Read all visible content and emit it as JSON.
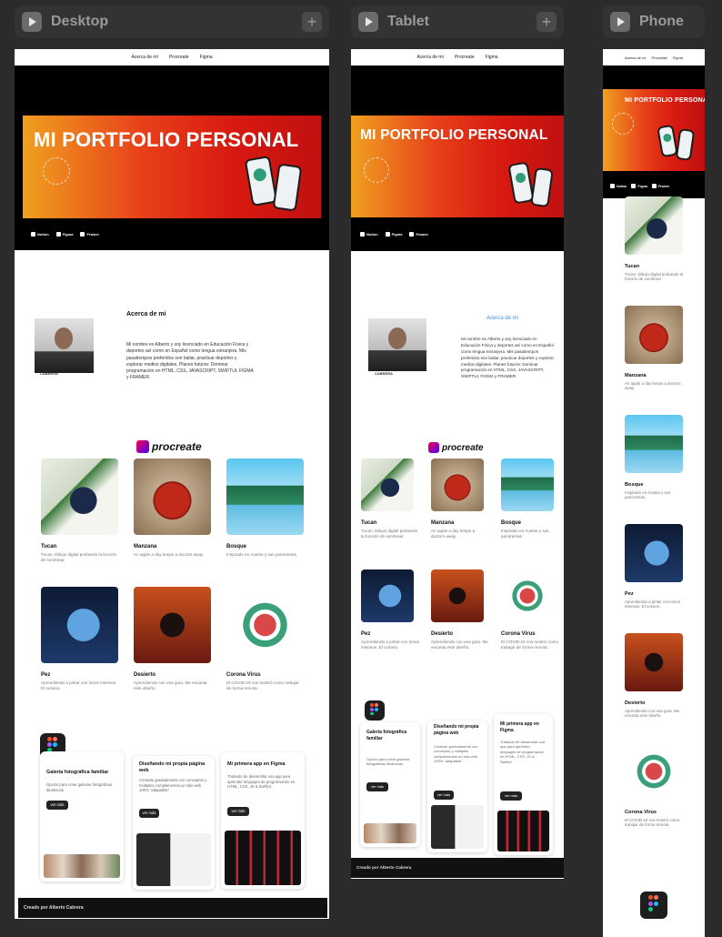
{
  "frames": {
    "desktop": {
      "label": "Desktop"
    },
    "tablet": {
      "label": "Tablet"
    },
    "phone": {
      "label": "Phone"
    }
  },
  "nav": {
    "about": "Acerca de mí",
    "procreate": "Procreate",
    "figma": "Figma"
  },
  "hero": {
    "title": "MI PORTFOLIO PERSONAL",
    "circle_text": "ALBERTO · CABRERA · 00"
  },
  "tools": {
    "notion": "Notion",
    "figma": "Figma",
    "framer": "Framer"
  },
  "about": {
    "heading": "Acerca de mi",
    "photo_caption": "CABRERA",
    "body": "Mi nombre es Alberto y soy licenciado en Educación Física y deportes así como en Español como lengua extranjera. Mis pasatiempos preferidos son bailar, practicar deportes y explorar medios digitales. Planes futuros: Dominar programación en HTML, CSS, JAVASCRIPT, SWIFTUI, FIGMA y FRAMER."
  },
  "procreate": {
    "badge": "procreate",
    "cards": [
      {
        "title": "Tucan",
        "desc": "Tucan. Dibujo digital probando la función de sombrear."
      },
      {
        "title": "Manzana",
        "desc": "An apple a day keeps a doctors away."
      },
      {
        "title": "Bosque",
        "desc": "Inspirado en Austria y sus panoramas."
      },
      {
        "title": "Pez",
        "desc": "Aprendiendo a pintar con tonos intensos. El océano."
      },
      {
        "title": "Desierto",
        "desc": "Aprendiendo con una guía. Me encanta este diseño."
      },
      {
        "title": "Corona Virus",
        "desc": "El COVID-19 nos mostró como trabajar de forma remota."
      }
    ]
  },
  "figma": {
    "projects": [
      {
        "title": "Galería fotográfica familiar",
        "desc": "Opción para crear galerías fotográficas dinámicas.",
        "button": "ver más"
      },
      {
        "title": "Diseñando mi propia página web",
        "desc": "Creando gradualmente con conceptos y múltiples complementos un sitio web 100% \"adaptable\"",
        "button": "ver más"
      },
      {
        "title": "Mi primera app en Figma",
        "desc": "Tratando de desarrollar una app para aprender lenguajes de programación en HTML, CSS, JS & SwiftUI.",
        "button": "ver más"
      }
    ]
  },
  "footer": {
    "text": "Creado por Alberto Cabrera"
  },
  "colors": {
    "bg": "#2b2b2b",
    "header": "#333333",
    "banner_from": "#f0a020",
    "banner_to": "#c01010",
    "link_blue": "#3a8ee6"
  }
}
